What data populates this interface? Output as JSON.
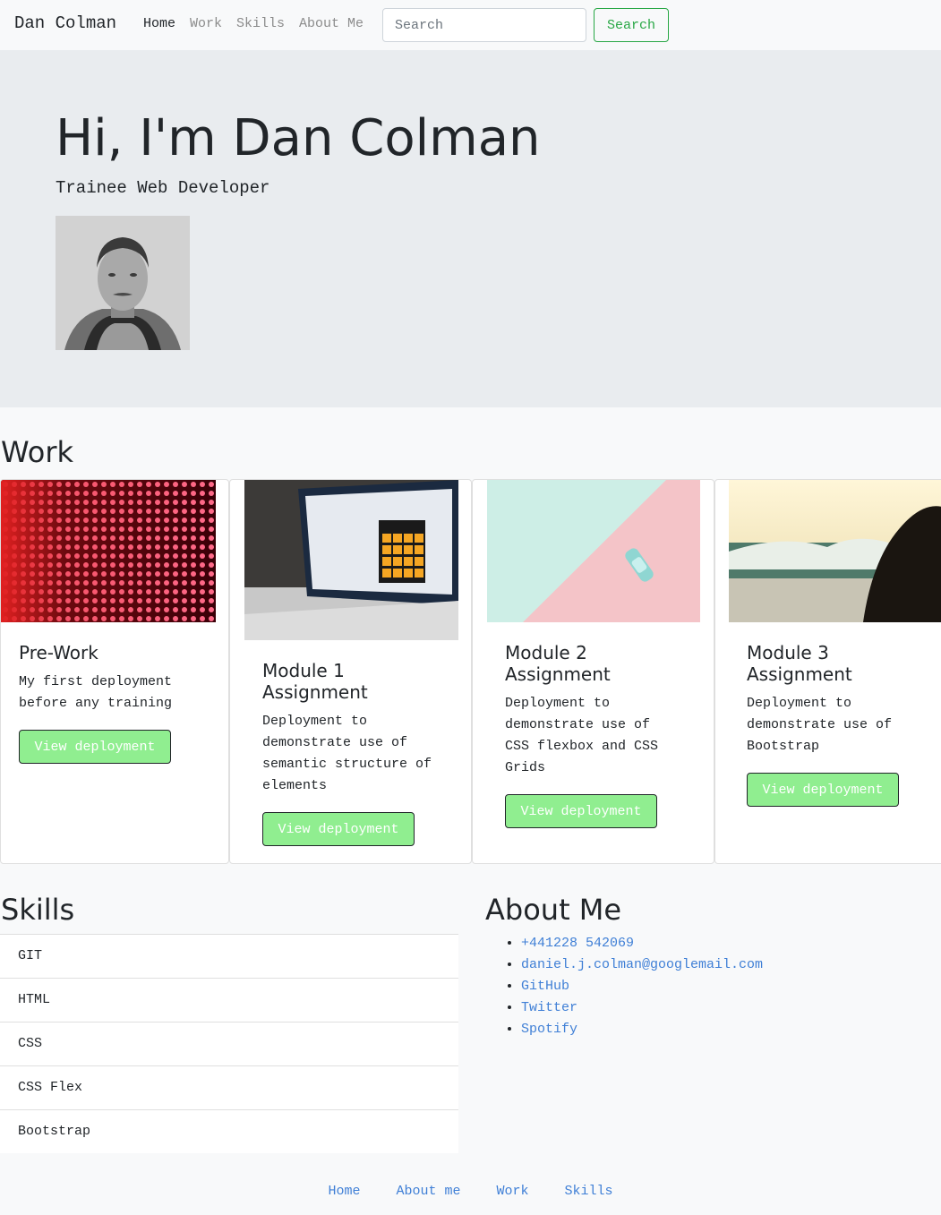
{
  "navbar": {
    "brand": "Dan Colman",
    "links": [
      "Home",
      "Work",
      "Skills",
      "About Me"
    ],
    "search_placeholder": "Search",
    "search_button": "Search"
  },
  "hero": {
    "title": "Hi, I'm Dan Colman",
    "subtitle": "Trainee Web Developer"
  },
  "work": {
    "title": "Work",
    "cards": [
      {
        "title": "Pre-Work",
        "text": "My first deployment before any training",
        "button": "View deployment"
      },
      {
        "title": "Module 1 Assignment",
        "text": "Deployment to demonstrate use of semantic structure of elements",
        "button": "View deployment"
      },
      {
        "title": "Module 2 Assignment",
        "text": "Deployment to demonstrate use of CSS flexbox and CSS Grids",
        "button": "View deployment"
      },
      {
        "title": "Module 3 Assignment",
        "text": "Deployment to demonstrate use of Bootstrap",
        "button": "View deployment"
      }
    ]
  },
  "skills": {
    "title": "Skills",
    "items": [
      "GIT",
      "HTML",
      "CSS",
      "CSS Flex",
      "Bootstrap"
    ]
  },
  "about": {
    "title": "About Me",
    "items": [
      "+441228 542069",
      "daniel.j.colman@googlemail.com",
      "GitHub",
      "Twitter",
      "Spotify"
    ]
  },
  "footer": {
    "links": [
      "Home",
      "About me",
      "Work",
      "Skills"
    ]
  }
}
